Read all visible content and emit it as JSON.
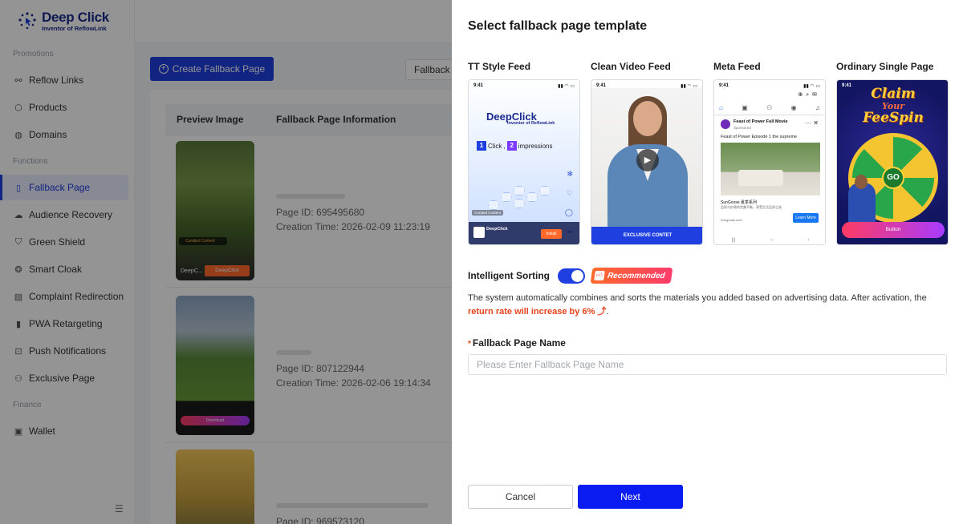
{
  "logo": {
    "title": "Deep Click",
    "subtitle": "Inventor of ReflowLink"
  },
  "sidebar": {
    "sections": [
      {
        "label": "Promotions",
        "items": [
          {
            "label": "Reflow Links",
            "icon": "link-icon"
          },
          {
            "label": "Products",
            "icon": "box-icon"
          },
          {
            "label": "Domains",
            "icon": "globe-icon"
          }
        ]
      },
      {
        "label": "Functions",
        "items": [
          {
            "label": "Fallback Page",
            "icon": "page-icon"
          },
          {
            "label": "Audience Recovery",
            "icon": "cloud-icon"
          },
          {
            "label": "Green Shield",
            "icon": "shield-icon"
          },
          {
            "label": "Smart Cloak",
            "icon": "cloak-icon"
          },
          {
            "label": "Complaint Redirection",
            "icon": "clipboard-icon"
          },
          {
            "label": "PWA Retargeting",
            "icon": "phone-icon"
          },
          {
            "label": "Push Notifications",
            "icon": "bell-icon"
          },
          {
            "label": "Exclusive Page",
            "icon": "users-icon"
          }
        ]
      },
      {
        "label": "Finance",
        "items": [
          {
            "label": "Wallet",
            "icon": "wallet-icon"
          }
        ]
      }
    ],
    "active": "Fallback Page"
  },
  "main": {
    "create_button": "Create Fallback Page",
    "fallback_chip": "Fallback I",
    "columns": [
      "Preview Image",
      "Fallback Page Information"
    ],
    "rows": [
      {
        "page_id": "Page ID:  695495680",
        "creation_time": "Creation Time:   2026-02-09 11:23:19",
        "thumb_text": "DeepC...",
        "thumb_button": "DeepClick",
        "thumb_badge": "Curated Content"
      },
      {
        "page_id": "Page ID:  807122944",
        "creation_time": "Creation Time:   2026-02-06 19:14:34",
        "thumb_button": "Download"
      },
      {
        "page_id": "Page ID:  969573120"
      }
    ]
  },
  "drawer": {
    "title": "Select fallback page template",
    "templates": [
      {
        "label": "TT Style Feed",
        "time": "9:41",
        "brand": "DeepClick",
        "brand_sub": "Inventor of ReflowLink",
        "stat_1": "1",
        "stat_mid": "Click ,",
        "stat_2": "2",
        "stat_end": "impressions",
        "footer_badge": "Curated Content",
        "footer_name": "DeepClick",
        "footer_button": "Install"
      },
      {
        "label": "Clean Video Feed",
        "time": "9:41",
        "button": "EXCLUSIVE CONTET"
      },
      {
        "label": "Meta Feed",
        "time": "9:41",
        "post_title": "Feast of Power Full Movie",
        "sponsored": "Sponsored",
        "caption": "Feast of Power Episode 1 the supreme",
        "ad_title": "SunGoose 夏季系列",
        "ad_desc": "品质与价格的完美平衡，享受生活品质之选",
        "domain": "Sungoose.com",
        "cta": "Learn More"
      },
      {
        "label": "Ordinary Single Page",
        "time": "9:41",
        "headline": "Claim",
        "headline_small": "Your",
        "headline_2": "FeeSpin",
        "center": "GO",
        "button": "Button"
      }
    ],
    "sorting": {
      "label": "Intelligent Sorting",
      "enabled": true,
      "badge": "Recommended",
      "description_prefix": "The system automatically combines and sorts the materials you added based on advertising data. After activation, the ",
      "description_highlight": "return rate will increase by 6%",
      "description_suffix": "."
    },
    "name_field": {
      "label": "Fallback Page Name",
      "placeholder": "Please Enter Fallback Page Name",
      "value": ""
    },
    "cancel": "Cancel",
    "next": "Next"
  },
  "colors": {
    "primary": "#1f3fe0",
    "next_button": "#0b1cf2",
    "highlight": "#e8431c"
  }
}
